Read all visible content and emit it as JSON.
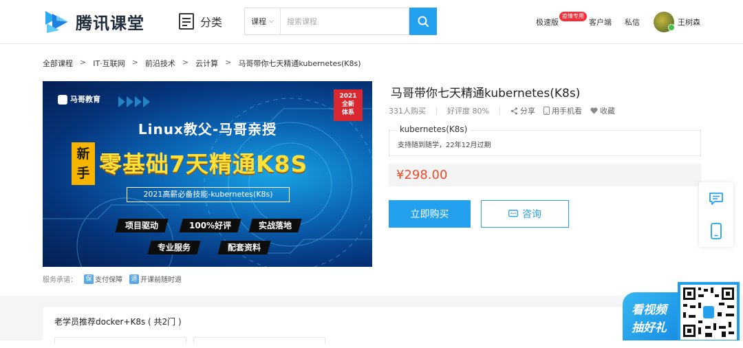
{
  "header": {
    "logo_text": "腾讯课堂",
    "category_label": "分类",
    "search_type": "课程",
    "search_placeholder": "搜索课程",
    "links": {
      "lite": "极速版",
      "lite_badge": "疫情专用",
      "client": "客户端",
      "message": "私信",
      "username": "王树森"
    }
  },
  "breadcrumb": [
    "全部课程",
    "IT·互联网",
    "前沿技术",
    "云计算",
    "马哥带你七天精通kubernetes(K8s)"
  ],
  "cover": {
    "brand": "马哥教育",
    "tag_year": "2021",
    "tag_line1": "全新",
    "tag_line2": "体系",
    "subtitle": "Linux教父-马哥亲授",
    "new_line1": "新",
    "new_line2": "手",
    "main_title": "零基础7天精通K8S",
    "banner": "2021高薪必备技能-kubernetes(K8s)",
    "pills": [
      "项目驱动",
      "100%好评",
      "实战落地",
      "专业服务",
      "配套资料"
    ]
  },
  "service": {
    "label": "服务承诺：",
    "items": [
      {
        "icon": "保",
        "text": "支付保障"
      },
      {
        "icon": "退",
        "text": "开课前随时退"
      }
    ]
  },
  "course": {
    "title": "马哥带你七天精通kubernetes(K8s)",
    "buyers": "331人购买",
    "rating": "好评度 80%",
    "share": "分享",
    "mobile": "用手机看",
    "favorite": "收藏",
    "plan_name": "kubernetes(K8s)",
    "plan_desc": "支持随到随学，22年12月过期",
    "price": "¥298.00",
    "buy_label": "立即购买",
    "consult_label": "咨询"
  },
  "package": {
    "title": "老学员推荐docker+K8s ( 共2门 )"
  },
  "promo": {
    "line1": "看视频",
    "line2": "抽好礼"
  },
  "colors": {
    "accent": "#23a1ef",
    "price": "#ef4a2a",
    "badge": "#f5303a"
  }
}
